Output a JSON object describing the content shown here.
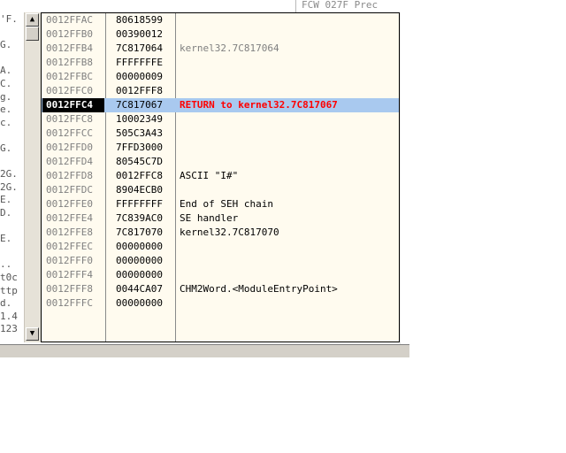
{
  "top_strip": "FCW 027F  Prec",
  "gutter": [
    "'F.",
    "",
    "G.",
    "",
    "A.",
    "C.",
    "g.",
    "e.",
    "c.",
    "",
    "G.",
    "",
    "2G.",
    "2G.",
    "E.",
    "D.",
    "",
    "E.",
    "",
    "..",
    "t0c",
    "ttp",
    "d.",
    "1.4",
    "123"
  ],
  "rows": [
    {
      "addr": "0012FFAC",
      "val": "80618599",
      "cmt": "",
      "style": ""
    },
    {
      "addr": "0012FFB0",
      "val": "00390012",
      "cmt": "",
      "style": ""
    },
    {
      "addr": "0012FFB4",
      "val": "7C817064",
      "cmt": "kernel32.7C817064",
      "style": "gray"
    },
    {
      "addr": "0012FFB8",
      "val": "FFFFFFFE",
      "cmt": "",
      "style": ""
    },
    {
      "addr": "0012FFBC",
      "val": "00000009",
      "cmt": "",
      "style": ""
    },
    {
      "addr": "0012FFC0",
      "val": "0012FFF8",
      "cmt": "",
      "style": ""
    },
    {
      "addr": "0012FFC4",
      "val": "7C817067",
      "cmt": "RETURN to kernel32.7C817067",
      "style": "red",
      "selected": true
    },
    {
      "addr": "0012FFC8",
      "val": "10002349",
      "cmt": "",
      "style": ""
    },
    {
      "addr": "0012FFCC",
      "val": "505C3A43",
      "cmt": "",
      "style": ""
    },
    {
      "addr": "0012FFD0",
      "val": "7FFD3000",
      "cmt": "",
      "style": ""
    },
    {
      "addr": "0012FFD4",
      "val": "80545C7D",
      "cmt": "",
      "style": ""
    },
    {
      "addr": "0012FFD8",
      "val": "0012FFC8",
      "cmt": "ASCII \"I#\"",
      "style": ""
    },
    {
      "addr": "0012FFDC",
      "val": "8904ECB0",
      "cmt": "",
      "style": ""
    },
    {
      "addr": "0012FFE0",
      "val": "FFFFFFFF",
      "cmt": "End of SEH chain",
      "style": ""
    },
    {
      "addr": "0012FFE4",
      "val": "7C839AC0",
      "cmt": "SE handler",
      "style": ""
    },
    {
      "addr": "0012FFE8",
      "val": "7C817070",
      "cmt": "kernel32.7C817070",
      "style": ""
    },
    {
      "addr": "0012FFEC",
      "val": "00000000",
      "cmt": "",
      "style": ""
    },
    {
      "addr": "0012FFF0",
      "val": "00000000",
      "cmt": "",
      "style": ""
    },
    {
      "addr": "0012FFF4",
      "val": "00000000",
      "cmt": "",
      "style": ""
    },
    {
      "addr": "0012FFF8",
      "val": "0044CA07",
      "cmt": "CHM2Word.<ModuleEntryPoint>",
      "style": ""
    },
    {
      "addr": "0012FFFC",
      "val": "00000000",
      "cmt": "",
      "style": ""
    }
  ],
  "icons": {
    "scroll_up": "up-arrow-icon",
    "scroll_down": "down-arrow-icon"
  },
  "colors": {
    "panel_bg": "#fffbef",
    "selected_bg": "#a9c9ef",
    "highlight_addr_bg": "#000000",
    "return_text": "#ff0000"
  }
}
